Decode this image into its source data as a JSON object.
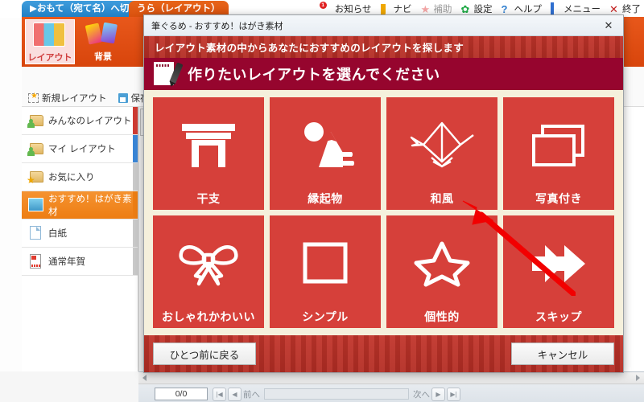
{
  "app": {
    "tabs": [
      {
        "label": "▶おもて（宛て名）へ切替",
        "name": "tab-omote"
      },
      {
        "label": "うら（レイアウト）",
        "name": "tab-ura"
      }
    ],
    "topmenu": [
      {
        "label": "お知らせ",
        "icon": "bell-icon",
        "badge": "1"
      },
      {
        "label": "ナビ",
        "icon": "navigation-cursor-icon"
      },
      {
        "label": "補助",
        "icon": "star-icon",
        "dim": true
      },
      {
        "label": "設定",
        "icon": "gear-icon"
      },
      {
        "label": "ヘルプ",
        "icon": "question-mark-icon"
      },
      {
        "label": "メニュー",
        "icon": "square-icon"
      },
      {
        "label": "終了",
        "icon": "close-x-icon"
      }
    ],
    "ribbon_tabs": [
      {
        "label": "レイアウト",
        "icon": "layout-book-icon",
        "selected": true
      },
      {
        "label": "背景",
        "icon": "background-cards-icon",
        "selected": false
      },
      {
        "label": "",
        "icon": "photo-icon",
        "selected": false
      }
    ],
    "commands": [
      {
        "label": "新規レイアウト",
        "icon": "new-layout-icon",
        "dropdown": false
      },
      {
        "label": "保存",
        "icon": "save-disk-icon",
        "dropdown": true
      }
    ],
    "list_items": [
      {
        "label": "みんなのレイアウト",
        "icon": "shared-folder-icon",
        "tag": "#cf3b32",
        "selected": false
      },
      {
        "label": "マイ レイアウト",
        "icon": "my-folder-icon",
        "tag": "#3a86d6",
        "selected": false
      },
      {
        "label": "お気に入り",
        "icon": "favorite-folder-icon",
        "tag": "#c9c9c9",
        "selected": false
      },
      {
        "label": "おすすめ！はがき素材",
        "icon": "recommend-icon",
        "tag": "#ed7d13",
        "selected": true
      },
      {
        "label": "白紙",
        "icon": "blank-page-icon",
        "tag": "#c9c9c9",
        "selected": false
      },
      {
        "label": "通常年賀",
        "icon": "nenga-card-icon",
        "tag": "#c9c9c9",
        "selected": false
      }
    ],
    "statusbar": {
      "page_counter": "0/0",
      "prev_label": "前へ",
      "next_label": "次へ"
    }
  },
  "dialog": {
    "title": "筆ぐるめ - おすすめ！はがき素材",
    "close_label": "✕",
    "banner": "レイアウト素材の中からあなたにおすすめのレイアウトを探します",
    "heading": "作りたいレイアウトを選んでください",
    "tiles": [
      {
        "label": "干支",
        "icon": "torii-gate-icon"
      },
      {
        "label": "縁起物",
        "icon": "mount-fuji-sunrise-icon"
      },
      {
        "label": "和風",
        "icon": "origami-crane-icon"
      },
      {
        "label": "写真付き",
        "icon": "photo-frame-icon"
      },
      {
        "label": "おしゃれかわいい",
        "icon": "ribbon-bow-icon"
      },
      {
        "label": "シンプル",
        "icon": "square-outline-icon"
      },
      {
        "label": "個性的",
        "icon": "star-outline-icon"
      },
      {
        "label": "スキップ",
        "icon": "fast-forward-arrow-icon"
      }
    ],
    "buttons": {
      "back": "ひとつ前に戻る",
      "cancel": "キャンセル"
    }
  },
  "annotation": {
    "arrow_color": "#f20000",
    "points_to": "和風"
  },
  "colors": {
    "tile_red": "#d6403a",
    "dialog_cream": "#f5f0dc",
    "heading_maroon": "#96052e",
    "banner_red": "#bb3027",
    "selected_orange": "#ed7d13",
    "tab_blue": "#2a84c8",
    "ribbon_orange": "#de4c10"
  }
}
